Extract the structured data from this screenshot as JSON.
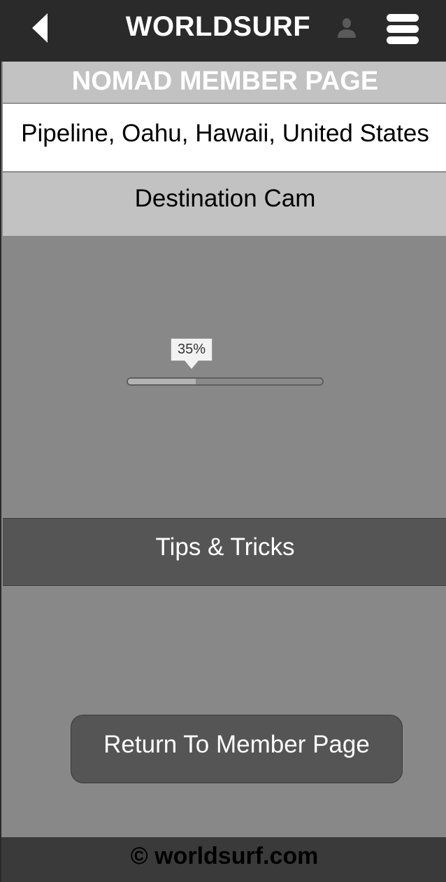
{
  "header": {
    "title": "WORLDSURF",
    "back_icon": "back-arrow-icon",
    "user_icon": "user-icon",
    "menu_icon": "hamburger-menu-icon",
    "background_color": "#2a2a2a"
  },
  "page": {
    "heading": "NOMAD MEMBER PAGE",
    "location": "Pipeline, Oahu, Hawaii, United States"
  },
  "destination_cam": {
    "label": "Destination Cam",
    "progress_label": "35%",
    "progress_value": 0.35
  },
  "tips": {
    "label": "Tips & Tricks"
  },
  "actions": {
    "return_label": "Return To Member Page"
  },
  "footer": {
    "text": "© worldsurf.com"
  }
}
